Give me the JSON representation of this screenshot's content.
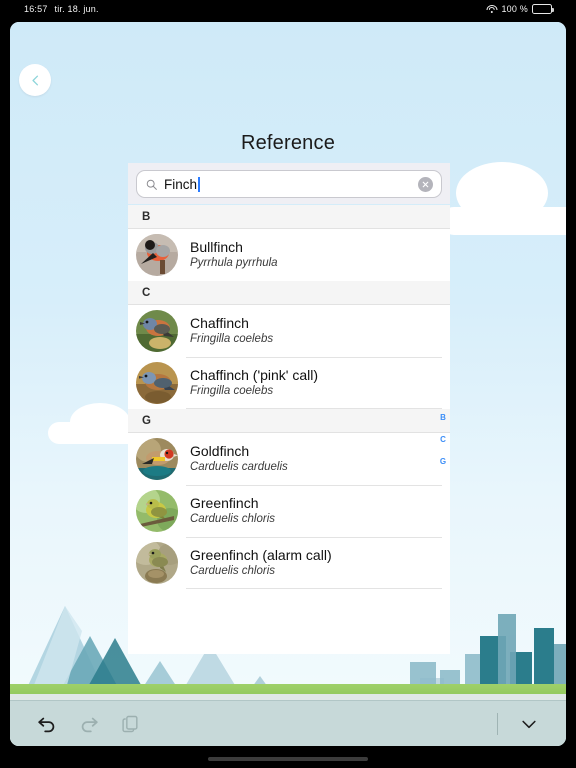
{
  "status_bar": {
    "time": "16:57",
    "date": "tir. 18. jun.",
    "battery_label": "100 %",
    "wifi_icon": "wifi-icon",
    "battery_icon": "battery-icon"
  },
  "nav": {
    "back_icon": "chevron-left-icon"
  },
  "page": {
    "title": "Reference"
  },
  "search": {
    "value": "Finch",
    "placeholder": "Search",
    "icon": "search-icon",
    "clear_icon": "clear-circle-icon"
  },
  "index_letters": [
    "B",
    "C",
    "G"
  ],
  "sections": [
    {
      "letter": "B",
      "rows": [
        {
          "name": "Bullfinch",
          "latin": "Pyrrhula pyrrhula",
          "thumb": "bullfinch-photo"
        }
      ]
    },
    {
      "letter": "C",
      "rows": [
        {
          "name": "Chaffinch",
          "latin": "Fringilla coelebs",
          "thumb": "chaffinch-photo"
        },
        {
          "name": "Chaffinch ('pink' call)",
          "latin": "Fringilla coelebs",
          "thumb": "chaffinch-pink-call-photo"
        }
      ]
    },
    {
      "letter": "G",
      "rows": [
        {
          "name": "Goldfinch",
          "latin": "Carduelis carduelis",
          "thumb": "goldfinch-photo"
        },
        {
          "name": "Greenfinch",
          "latin": "Carduelis chloris",
          "thumb": "greenfinch-photo"
        },
        {
          "name": "Greenfinch (alarm call)",
          "latin": "Carduelis chloris",
          "thumb": "greenfinch-alarm-call-photo"
        }
      ]
    }
  ],
  "toolbar": {
    "undo_icon": "undo-icon",
    "redo_icon": "redo-icon",
    "copy_icon": "copy-icon",
    "collapse_icon": "chevron-down-icon"
  },
  "colors": {
    "sky": "#cfeaf8",
    "accent_index": "#3d8ef7",
    "caret": "#2b7cff",
    "toolbar": "#c4d8d8",
    "grass": "#9fd06a"
  }
}
